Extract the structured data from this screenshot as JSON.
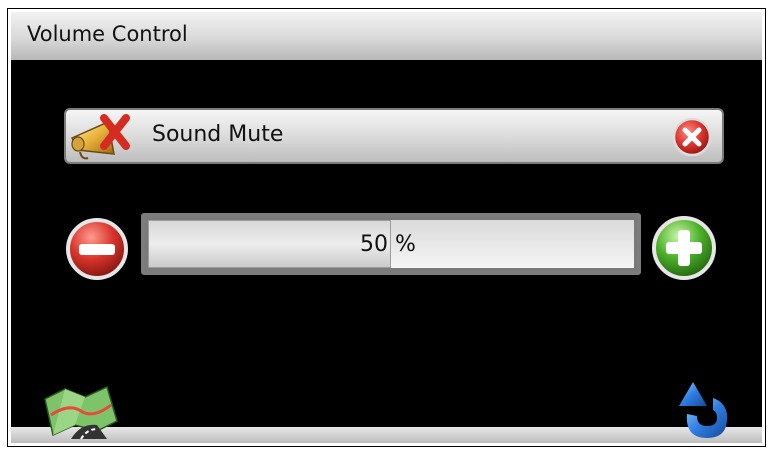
{
  "window": {
    "title": "Volume Control"
  },
  "mute": {
    "label": "Sound Mute",
    "icon": "speaker-muted-icon",
    "close_icon": "close-icon"
  },
  "volume": {
    "percent": 50,
    "value_label": "50",
    "unit_label": " %",
    "decrease_icon": "minus-icon",
    "increase_icon": "plus-icon"
  },
  "footer": {
    "left_icon": "map-icon",
    "right_icon": "back-arrow-icon"
  },
  "colors": {
    "accent_red": "#d9342b",
    "accent_green": "#4caf2a",
    "accent_blue": "#2f7de1"
  }
}
